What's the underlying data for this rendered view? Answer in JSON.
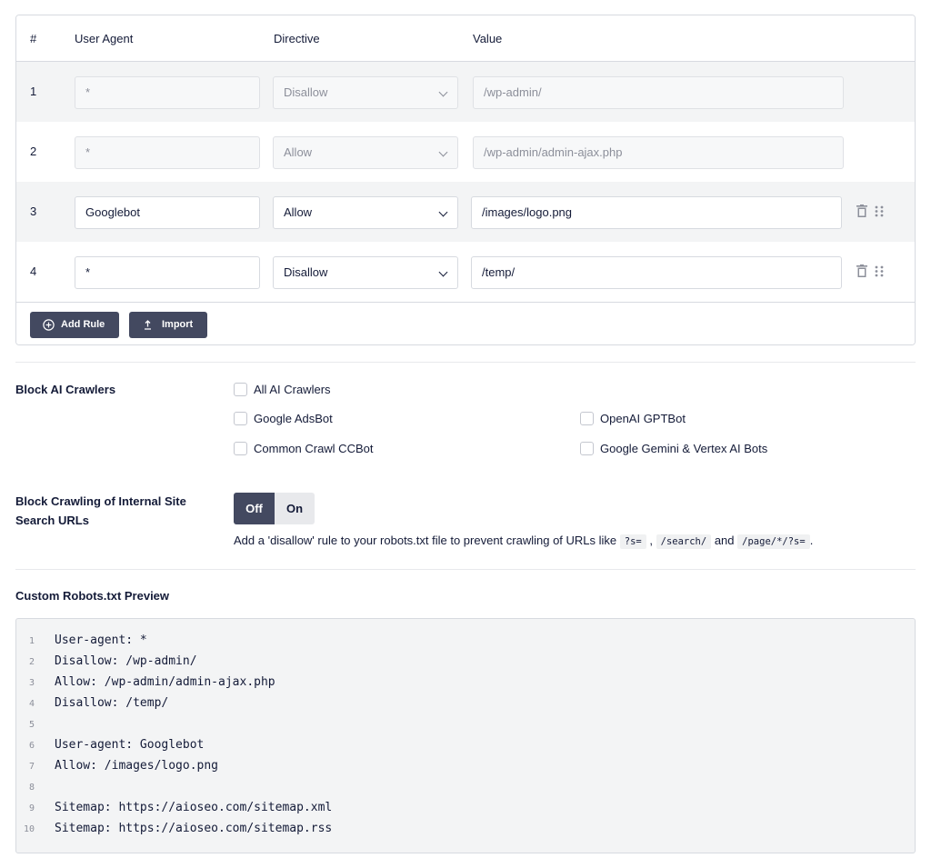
{
  "rules_table": {
    "headers": {
      "num": "#",
      "user_agent": "User Agent",
      "directive": "Directive",
      "value": "Value"
    },
    "rows": [
      {
        "num": "1",
        "user_agent": "*",
        "directive": "Disallow",
        "value": "/wp-admin/",
        "editable": false
      },
      {
        "num": "2",
        "user_agent": "*",
        "directive": "Allow",
        "value": "/wp-admin/admin-ajax.php",
        "editable": false
      },
      {
        "num": "3",
        "user_agent": "Googlebot",
        "directive": "Allow",
        "value": "/images/logo.png",
        "editable": true
      },
      {
        "num": "4",
        "user_agent": "*",
        "directive": "Disallow",
        "value": "/temp/",
        "editable": true
      }
    ],
    "add_rule_label": "Add Rule",
    "import_label": "Import"
  },
  "block_ai": {
    "label": "Block AI Crawlers",
    "options": [
      {
        "label": "All AI Crawlers",
        "checked": false
      },
      {
        "label": "Google AdsBot",
        "checked": false
      },
      {
        "label": "OpenAI GPTBot",
        "checked": false
      },
      {
        "label": "Common Crawl CCBot",
        "checked": false
      },
      {
        "label": "Google Gemini & Vertex AI Bots",
        "checked": false
      }
    ]
  },
  "block_search": {
    "label": "Block Crawling of Internal Site Search URLs",
    "toggle_off": "Off",
    "toggle_on": "On",
    "selected": "Off",
    "desc_prefix": "Add a 'disallow' rule to your robots.txt file to prevent crawling of URLs like",
    "code1": "?s=",
    "sep1": ",",
    "code2": "/search/",
    "sep2": "and",
    "code3": "/page/*/?s=",
    "desc_suffix": "."
  },
  "preview": {
    "label": "Custom Robots.txt Preview",
    "lines": [
      {
        "n": "1",
        "text": "User-agent: *"
      },
      {
        "n": "2",
        "text": "Disallow: /wp-admin/"
      },
      {
        "n": "3",
        "text": "Allow: /wp-admin/admin-ajax.php"
      },
      {
        "n": "4",
        "text": "Disallow: /temp/"
      },
      {
        "n": "5",
        "text": ""
      },
      {
        "n": "6",
        "text": "User-agent: Googlebot"
      },
      {
        "n": "7",
        "text": "Allow: /images/logo.png"
      },
      {
        "n": "8",
        "text": ""
      },
      {
        "n": "9",
        "text": "Sitemap: https://aioseo.com/sitemap.xml"
      },
      {
        "n": "10",
        "text": "Sitemap: https://aioseo.com/sitemap.rss"
      }
    ]
  },
  "colors": {
    "dark_button": "#434960",
    "text": "#141b38",
    "row_shade": "#f3f4f5",
    "border": "#d7dae0"
  },
  "icons": {
    "add": "plus-circle-icon",
    "import": "upload-icon",
    "delete": "trash-icon",
    "drag": "drag-handle-icon",
    "select": "chevron-down-icon"
  }
}
